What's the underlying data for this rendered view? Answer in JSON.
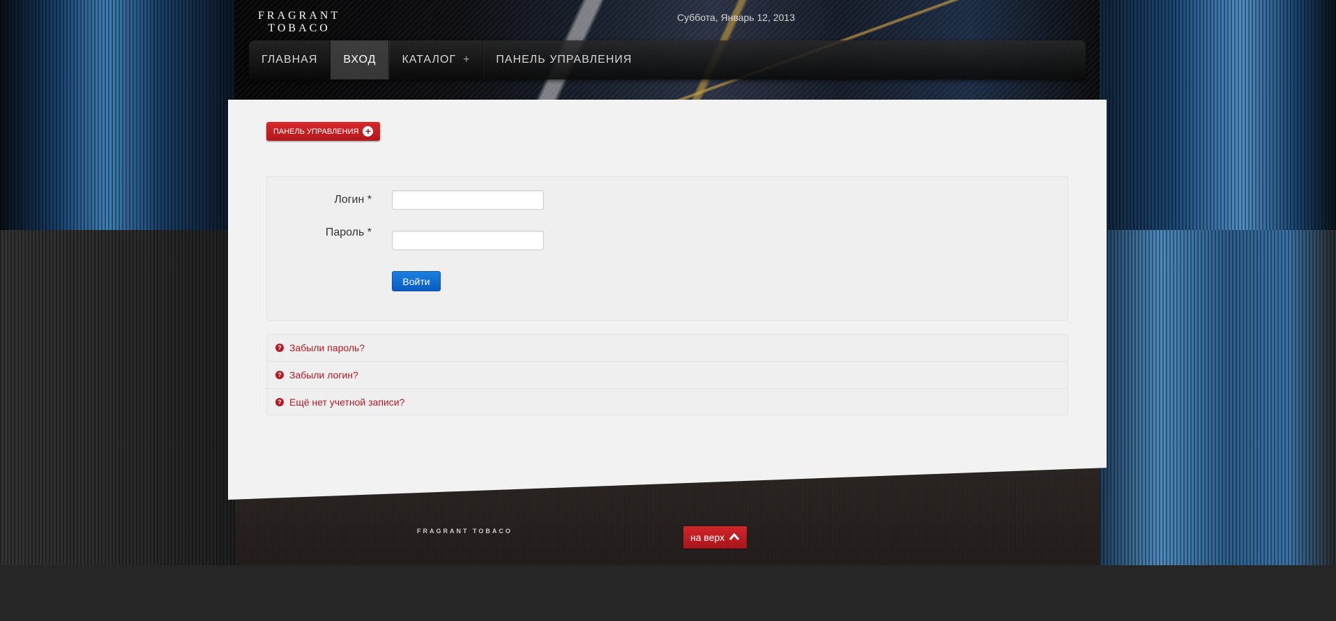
{
  "header": {
    "logo_line1": "FRAGRANT",
    "logo_line2": "TOBACO",
    "date": "Суббота, Январь 12, 2013"
  },
  "nav": {
    "items": [
      {
        "label": "ГЛАВНАЯ"
      },
      {
        "label": "ВХОД"
      },
      {
        "label": "КАТАЛОГ"
      },
      {
        "label": "ПАНЕЛЬ УПРАВЛЕНИЯ"
      }
    ],
    "catalog_plus": "+"
  },
  "control_panel_button": {
    "label": "ПАНЕЛЬ УПРАВЛЕНИЯ",
    "icon": "plus-circle-icon",
    "icon_glyph": "+"
  },
  "login_form": {
    "login_label": "Логин *",
    "login_value": "",
    "password_label": "Пароль *",
    "password_value": "",
    "submit_label": "Войти"
  },
  "links": [
    {
      "label": "Забыли пароль?"
    },
    {
      "label": "Забыли логин?"
    },
    {
      "label": "Ещё нет учетной записи?"
    }
  ],
  "link_icon_glyph": "?",
  "footer": {
    "logo": "FRAGRANT TOBACO",
    "to_top_label": "на верх"
  },
  "colors": {
    "accent_red": "#b51a22",
    "button_blue": "#0a5cc2"
  }
}
